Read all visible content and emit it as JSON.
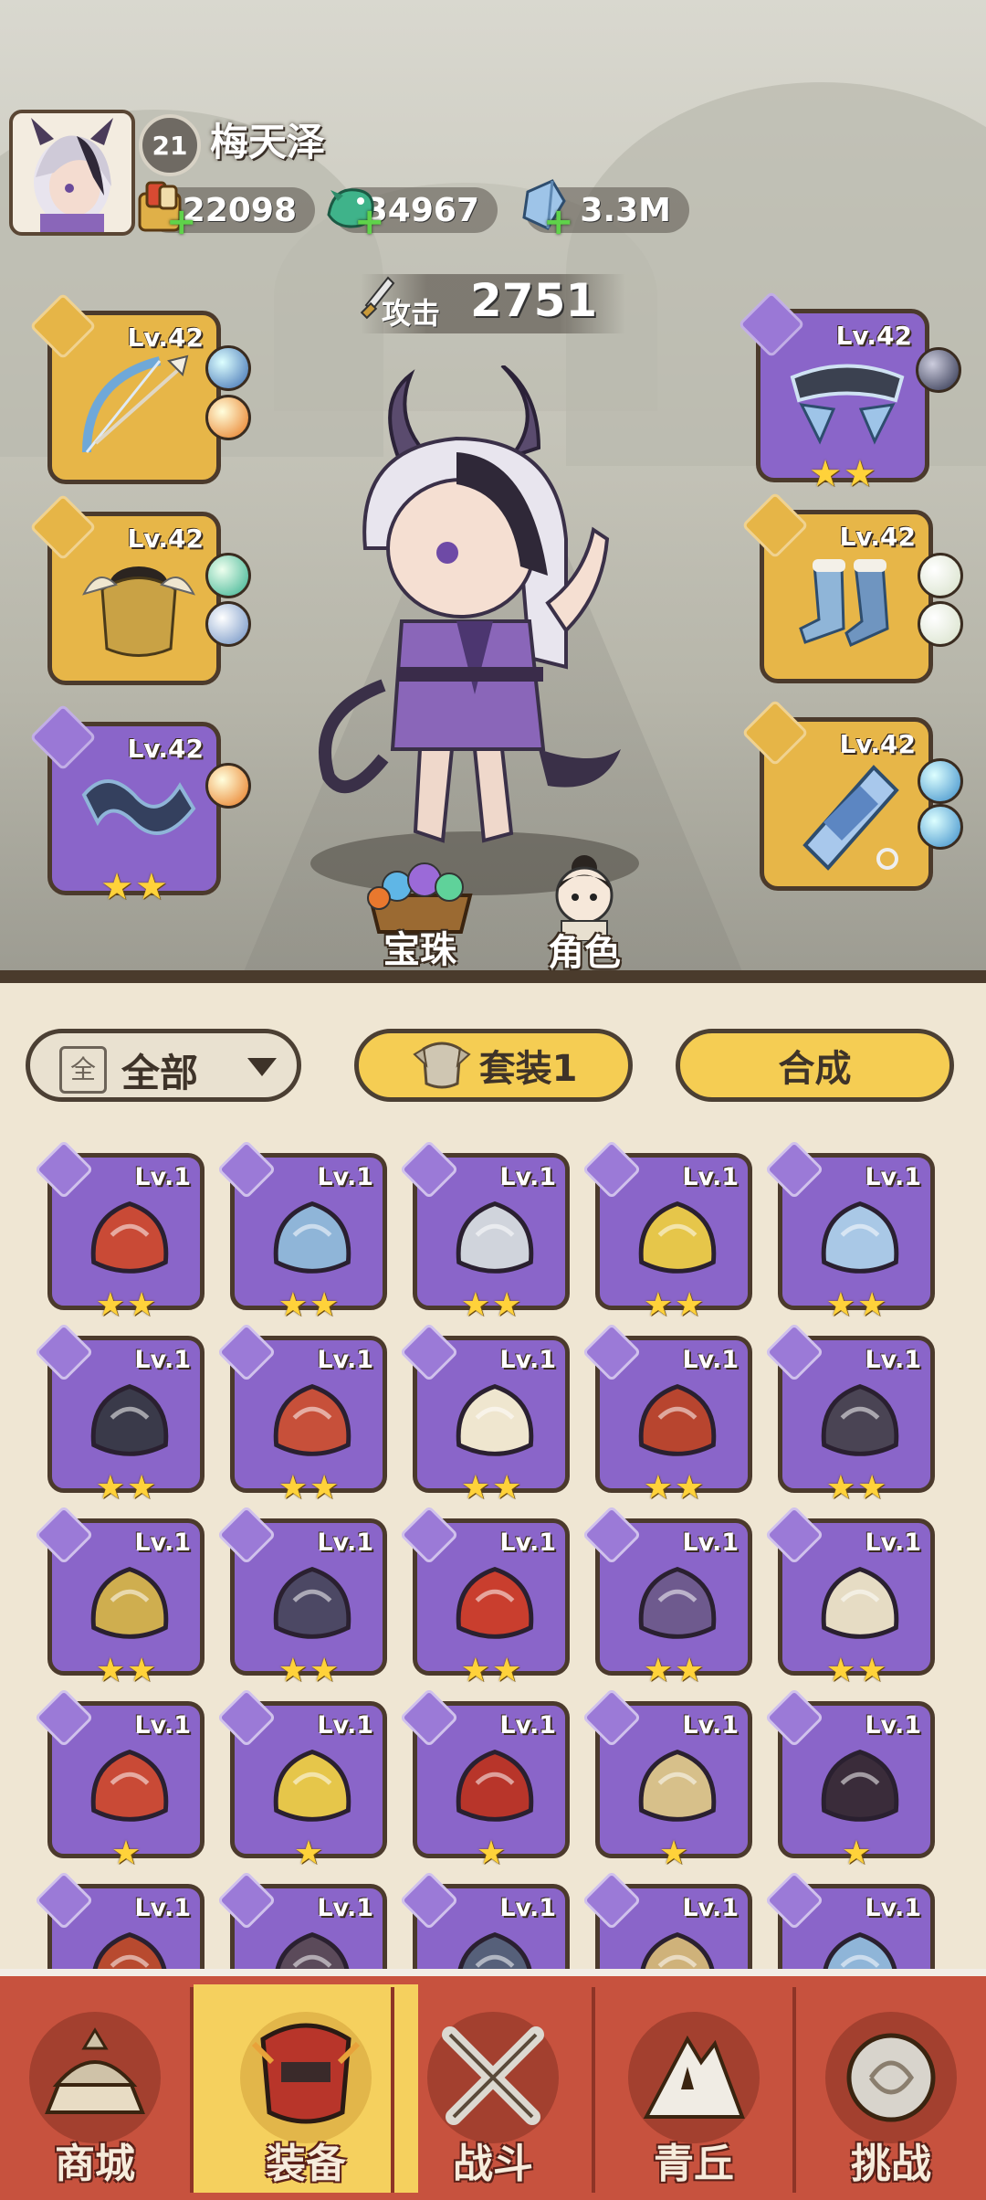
{
  "player": {
    "level": "21",
    "name": "梅天泽",
    "currencies": [
      {
        "icon": "scroll-bundle-icon",
        "value": "22098"
      },
      {
        "icon": "jade-dragon-icon",
        "value": "34967"
      },
      {
        "icon": "crystal-icon",
        "value": "3.3M"
      }
    ]
  },
  "attack": {
    "label": "攻击",
    "value": "2751"
  },
  "equipped": {
    "left": [
      {
        "slot": "weapon",
        "level": "Lv.42",
        "rarity": "gold",
        "stars": 0
      },
      {
        "slot": "armor",
        "level": "Lv.42",
        "rarity": "gold",
        "stars": 0
      },
      {
        "slot": "accessory",
        "level": "Lv.42",
        "rarity": "purple",
        "stars": 2
      }
    ],
    "right": [
      {
        "slot": "belt",
        "level": "Lv.42",
        "rarity": "purple",
        "stars": 2
      },
      {
        "slot": "boots",
        "level": "Lv.42",
        "rarity": "gold",
        "stars": 0
      },
      {
        "slot": "pendant",
        "level": "Lv.42",
        "rarity": "gold",
        "stars": 0
      }
    ]
  },
  "scene_buttons": {
    "gems": "宝珠",
    "role": "角色"
  },
  "toolbar": {
    "filter": "全部",
    "filter_box": "全",
    "set": "套装1",
    "craft": "合成"
  },
  "inventory": [
    {
      "level": "Lv.1",
      "stars": 2,
      "icon": "red-flower-whip-icon"
    },
    {
      "level": "Lv.1",
      "stars": 2,
      "icon": "bow-icon"
    },
    {
      "level": "Lv.1",
      "stars": 2,
      "icon": "hammer-icon"
    },
    {
      "level": "Lv.1",
      "stars": 2,
      "icon": "golden-staff-icon"
    },
    {
      "level": "Lv.1",
      "stars": 2,
      "icon": "ice-armor-icon"
    },
    {
      "level": "Lv.1",
      "stars": 2,
      "icon": "dark-armor-icon"
    },
    {
      "level": "Lv.1",
      "stars": 2,
      "icon": "red-horn-icon"
    },
    {
      "level": "Lv.1",
      "stars": 2,
      "icon": "white-tail-icon"
    },
    {
      "level": "Lv.1",
      "stars": 2,
      "icon": "lotus-belt-icon"
    },
    {
      "level": "Lv.1",
      "stars": 2,
      "icon": "dark-belt-icon"
    },
    {
      "level": "Lv.1",
      "stars": 2,
      "icon": "gold-belt-icon"
    },
    {
      "level": "Lv.1",
      "stars": 2,
      "icon": "dark-boots-icon"
    },
    {
      "level": "Lv.1",
      "stars": 2,
      "icon": "red-orb-icon"
    },
    {
      "level": "Lv.1",
      "stars": 2,
      "icon": "dark-orb-icon"
    },
    {
      "level": "Lv.1",
      "stars": 2,
      "icon": "bone-pendant-icon"
    },
    {
      "level": "Lv.1",
      "stars": 1,
      "icon": "red-flower-whip-icon"
    },
    {
      "level": "Lv.1",
      "stars": 1,
      "icon": "golden-staff-icon"
    },
    {
      "level": "Lv.1",
      "stars": 1,
      "icon": "red-armor-icon"
    },
    {
      "level": "Lv.1",
      "stars": 1,
      "icon": "gold-armor-icon"
    },
    {
      "level": "Lv.1",
      "stars": 1,
      "icon": "dark-horn-icon"
    },
    {
      "level": "Lv.1",
      "stars": 0,
      "icon": "red-belt-icon"
    },
    {
      "level": "Lv.1",
      "stars": 0,
      "icon": "red-boots-icon"
    },
    {
      "level": "Lv.1",
      "stars": 0,
      "icon": "blue-boots-icon"
    },
    {
      "level": "Lv.1",
      "stars": 0,
      "icon": "gold-boots-icon"
    },
    {
      "level": "Lv.1",
      "stars": 0,
      "icon": "bow-icon"
    }
  ],
  "nav": [
    {
      "label": "商城",
      "icon": "shop-pagoda-icon",
      "active": false
    },
    {
      "label": "装备",
      "icon": "helmet-icon",
      "active": true
    },
    {
      "label": "战斗",
      "icon": "crossed-swords-icon",
      "active": false
    },
    {
      "label": "青丘",
      "icon": "mountain-icon",
      "active": false
    },
    {
      "label": "挑战",
      "icon": "challenge-disc-icon",
      "active": false
    }
  ],
  "colors": {
    "gold_slot": "#e7b648",
    "purple_slot": "#8a65c9",
    "nav_bg": "#c7523e",
    "nav_active": "#f5d05e",
    "button_yellow": "#f5cd53"
  }
}
